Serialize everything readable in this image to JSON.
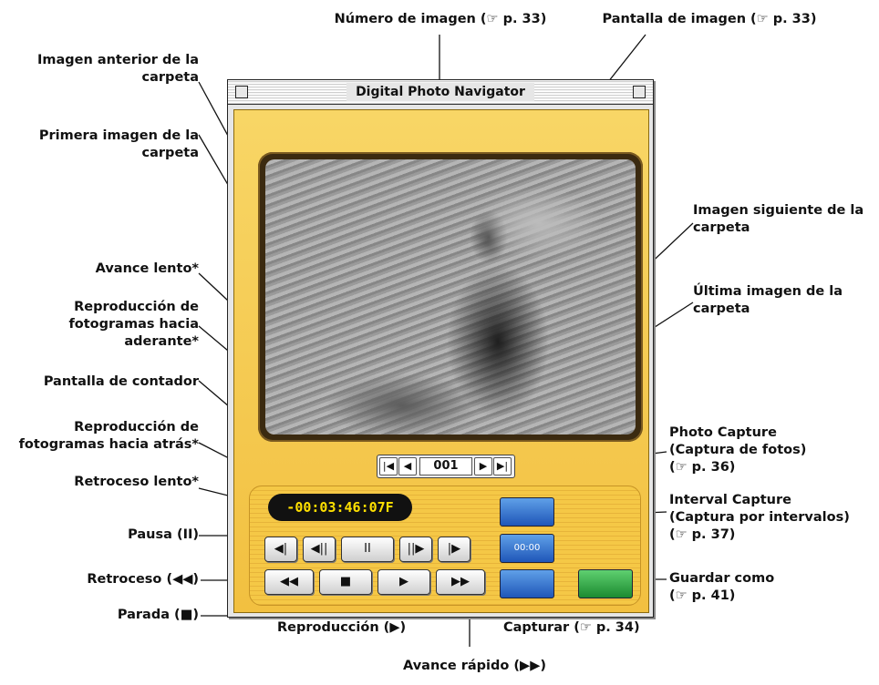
{
  "window": {
    "title": "Digital Photo Navigator",
    "navigator": {
      "first": "|◀",
      "prev": "◀",
      "image_number": "001",
      "next": "▶",
      "last": "▶|"
    },
    "counter": "-00:03:46:07F",
    "controls": {
      "slow_rewind": "◀|",
      "frame_back": "◀||",
      "pause": "II",
      "frame_forward": "||▶",
      "slow_forward": "|▶",
      "rewind": "◀◀",
      "stop": "■",
      "play": "▶",
      "fast_forward": "▶▶"
    },
    "capture_buttons": {
      "photo": "",
      "interval": "00:00",
      "capture": "",
      "save_as": ""
    }
  },
  "annotations": {
    "image_number": "Número de imagen (☞ p. 33)",
    "image_screen": "Pantalla de imagen (☞ p. 33)",
    "prev_image_l1": "Imagen anterior de la",
    "prev_image_l2": "carpeta",
    "first_image_l1": "Primera imagen de la",
    "first_image_l2": "carpeta",
    "next_image_l1": "Imagen siguiente de la",
    "next_image_l2": "carpeta",
    "last_image_l1": "Última imagen de la",
    "last_image_l2": "carpeta",
    "slow_forward": "Avance lento*",
    "frame_fwd_l1": "Reproducción de",
    "frame_fwd_l2": "fotogramas hacia",
    "frame_fwd_l3": "aderante*",
    "counter": "Pantalla de contador",
    "frame_back_l1": "Reproducción de",
    "frame_back_l2": "fotogramas hacia atrás*",
    "slow_rewind": "Retroceso lento*",
    "pause": "Pausa (II)",
    "rewind": "Retroceso (◀◀)",
    "stop": "Parada (■)",
    "play": "Reproducción (▶)",
    "fast_forward": "Avance rápido (▶▶)",
    "photo_capture_l1": "Photo Capture",
    "photo_capture_l2": "(Captura de fotos)",
    "photo_capture_l3": "(☞ p. 36)",
    "interval_capture_l1": "Interval Capture",
    "interval_capture_l2": "(Captura por intervalos)",
    "interval_capture_l3": "(☞ p. 37)",
    "save_as_l1": "Guardar como",
    "save_as_l2": "(☞ p. 41)",
    "capture": "Capturar (☞ p. 34)"
  }
}
